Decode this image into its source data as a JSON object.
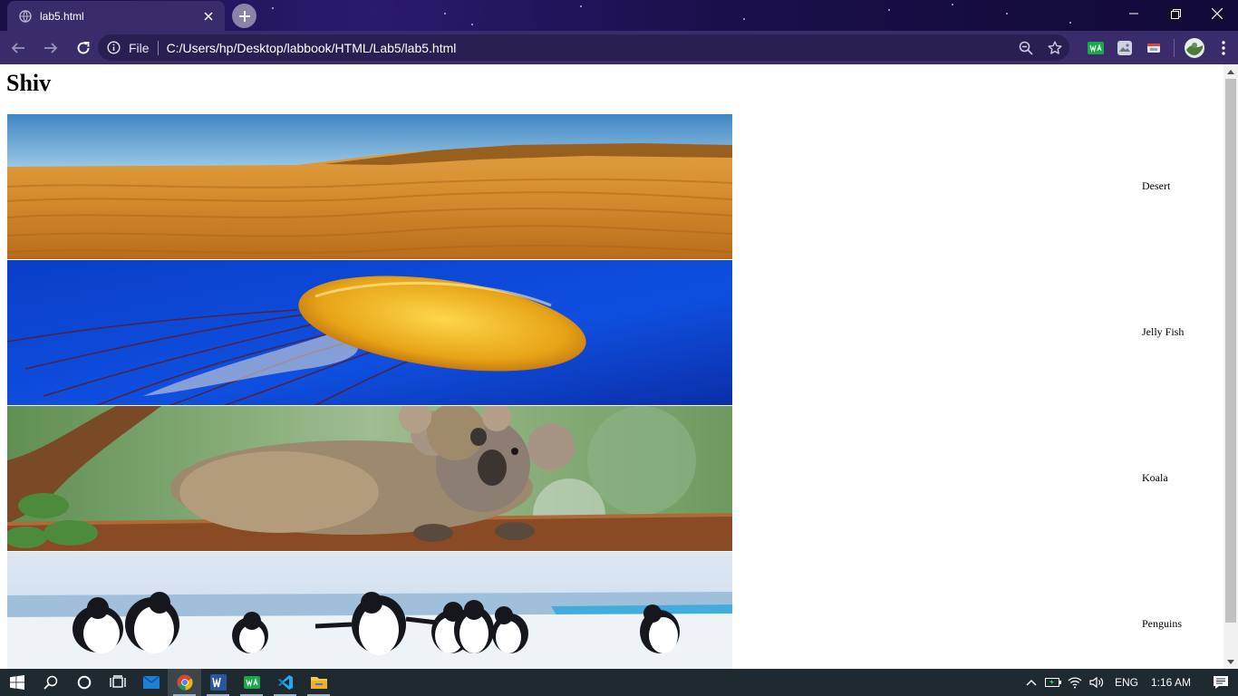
{
  "browser": {
    "tab_title": "lab5.html",
    "scheme_label": "File",
    "url": "C:/Users/hp/Desktop/labbook/HTML/Lab5/lab5.html",
    "extensions": [
      "whatsapp-extension",
      "gallery-extension",
      "cast-extension"
    ]
  },
  "page": {
    "heading": "Shiv",
    "items": [
      {
        "image": "desert",
        "caption": "Desert"
      },
      {
        "image": "jellyfish",
        "caption": "Jelly Fish"
      },
      {
        "image": "koala",
        "caption": "Koala"
      },
      {
        "image": "penguins",
        "caption": "Penguins"
      }
    ]
  },
  "taskbar": {
    "apps": [
      "start-icon",
      "search-icon",
      "cortana-icon",
      "task-view-icon",
      "mail-icon",
      "chrome-icon",
      "word-icon",
      "whatsapp-icon",
      "vscode-icon",
      "file-explorer-icon"
    ],
    "language": "ENG",
    "time": "1:16 AM"
  },
  "colors": {
    "titlebar": "#1a0f4a",
    "toolbar": "#3a2c6b",
    "omnibox": "#2a1f52",
    "taskbar": "#1f2a30"
  }
}
